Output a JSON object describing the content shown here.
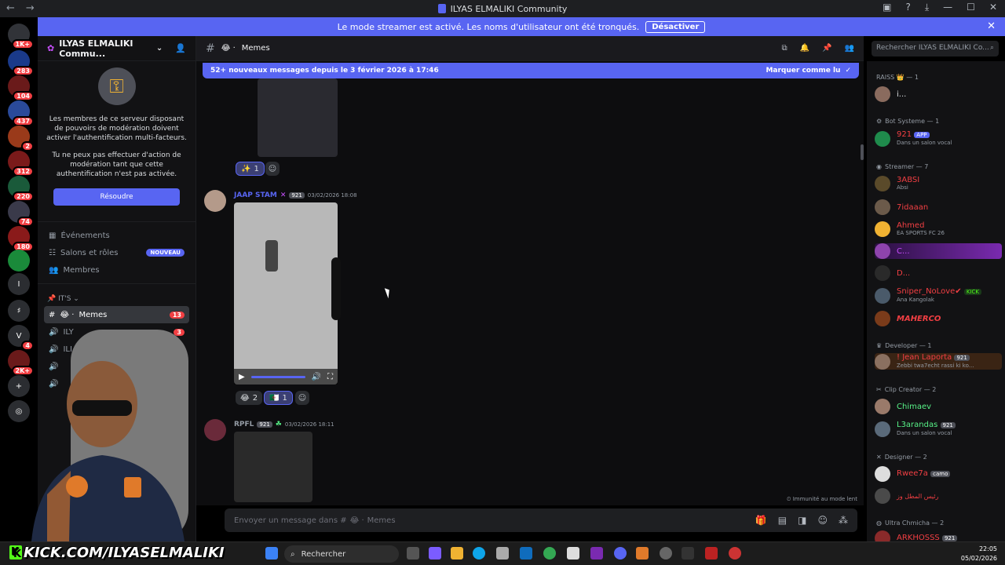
{
  "window": {
    "title": "ILYAS ELMALIKI Community",
    "controls": [
      "←",
      "→"
    ]
  },
  "banner": {
    "text": "Le mode streamer est activé. Les noms d'utilisateur ont été tronqués.",
    "button": "Désactiver",
    "close": "✕"
  },
  "servers": [
    {
      "label": "",
      "badge": "1K+"
    },
    {
      "label": "",
      "badge": "283"
    },
    {
      "label": "",
      "badge": "104"
    },
    {
      "label": "",
      "badge": "437"
    },
    {
      "label": "",
      "badge": "2"
    },
    {
      "label": "",
      "badge": "312"
    },
    {
      "label": "",
      "badge": "220"
    },
    {
      "label": "",
      "badge": "74"
    },
    {
      "label": "",
      "badge": "180"
    },
    {
      "label": "",
      "badge": ""
    },
    {
      "label": "I",
      "badge": ""
    },
    {
      "label": "♯",
      "badge": ""
    },
    {
      "label": "V",
      "badge": "4"
    },
    {
      "label": "",
      "badge": "2K+"
    },
    {
      "label": "+",
      "badge": ""
    },
    {
      "label": "◎",
      "badge": ""
    }
  ],
  "sidebar": {
    "server_name": "ILYAS ELMALIKI Commu...",
    "mfa_text1": "Les membres de ce serveur disposant de pouvoirs de modération doivent activer l'authentification multi-facteurs.",
    "mfa_text2": "Tu ne peux pas effectuer d'action de modération tant que cette authentification n'est pas activée.",
    "resolve": "Résoudre",
    "menu": [
      {
        "label": "Événements",
        "tag": ""
      },
      {
        "label": "Salons et rôles",
        "tag": "NOUVEAU"
      },
      {
        "label": "Membres",
        "tag": ""
      }
    ],
    "category": "IT'S",
    "channels": [
      {
        "label": "Memes",
        "count": "13",
        "active": true
      },
      {
        "label": "ILY",
        "count": "3",
        "active": false
      },
      {
        "label": "ILI",
        "count": "",
        "active": false
      },
      {
        "label": "",
        "count": "",
        "active": false
      },
      {
        "label": "",
        "count": "3",
        "active": false
      }
    ]
  },
  "chat": {
    "channel": "Memes",
    "new_messages": "52+ nouveaux messages depuis le 3 février 2026 à 17:46",
    "mark_read": "Marquer comme lu",
    "reactions_top": [
      {
        "emoji": "✨",
        "count": "1"
      }
    ],
    "message1": {
      "author": "JAAP STAM",
      "badge": "921",
      "time": "03/02/2026 18:08"
    },
    "reactions1": [
      {
        "emoji": "😂",
        "count": "2"
      },
      {
        "emoji": "🇩🇿",
        "count": "1"
      }
    ],
    "message2": {
      "author": "RPFL",
      "badge": "921",
      "time": "03/02/2026 18:11"
    },
    "slow_mode": "Immunité au mode lent",
    "composer_placeholder": "Envoyer un message dans #",
    "composer_channel": "Memes"
  },
  "search": {
    "placeholder": "Rechercher ILYAS ELMALIKI Co..."
  },
  "members": {
    "roles": [
      {
        "name": "RAISS 👑 — 1"
      },
      {
        "name": "Bot Systeme — 1"
      },
      {
        "name": "Streamer — 7"
      },
      {
        "name": "Developer — 1"
      },
      {
        "name": "Clip Creator — 2"
      },
      {
        "name": "Designer — 2"
      },
      {
        "name": "Ultra Chmicha — 2"
      }
    ],
    "list": [
      {
        "name": "i...",
        "sub": "",
        "color": "#dbdee1",
        "avatar": "#8a6b5e"
      },
      {
        "name": "921",
        "sub": "Dans un salon vocal",
        "color": "#f23f43",
        "avatar": "#1f8b4c",
        "tag": "APP"
      },
      {
        "name": "3ABSI",
        "sub": "Absi",
        "color": "#f23f43",
        "avatar": "#5a4a2a"
      },
      {
        "name": "7idaaan",
        "sub": "",
        "color": "#f23f43",
        "avatar": "#6b5a4a"
      },
      {
        "name": "Ahmed",
        "sub": "EA SPORTS FC 26",
        "color": "#f23f43",
        "avatar": "#f0b232"
      },
      {
        "name": "C...",
        "sub": "",
        "color": "#c94fff",
        "avatar": "#8e44ad"
      },
      {
        "name": "D...",
        "sub": "",
        "color": "#f23f43",
        "avatar": "#2a2a2a"
      },
      {
        "name": "Sniper_NoLove✔",
        "sub": "Ana Kangolak",
        "color": "#f23f43",
        "avatar": "#4a5a6a",
        "tag": "KICK"
      },
      {
        "name": "MAHERCO",
        "sub": "",
        "color": "#f23f43",
        "avatar": "#7a3b1a"
      },
      {
        "name": "! Jean Laporta",
        "sub": "Zebbi twa7echt rassi ki ko...",
        "color": "#f23f43",
        "avatar": "#8a7060",
        "tag": "921"
      },
      {
        "name": "Chimaev",
        "sub": "",
        "color": "#57f287",
        "avatar": "#9a7a6a"
      },
      {
        "name": "L3arandas",
        "sub": "Dans un salon vocal",
        "color": "#57f287",
        "avatar": "#5a6a7a",
        "tag": "921"
      },
      {
        "name": "Rwee7a",
        "sub": "",
        "color": "#f23f43",
        "avatar": "#dddddd",
        "tag": "camo"
      },
      {
        "name": "رئيس المطل وز",
        "sub": "",
        "color": "#f23f43",
        "avatar": "#4a4a4a"
      },
      {
        "name": "ARKHOSSS",
        "sub": "",
        "color": "#f23f43",
        "avatar": "#8a2a2a",
        "tag": "921"
      }
    ]
  },
  "taskbar": {
    "search": "Rechercher",
    "time": "22:05",
    "date": "05/02/2026",
    "kick": "KICK.COM/ILYASELMALIKI"
  }
}
